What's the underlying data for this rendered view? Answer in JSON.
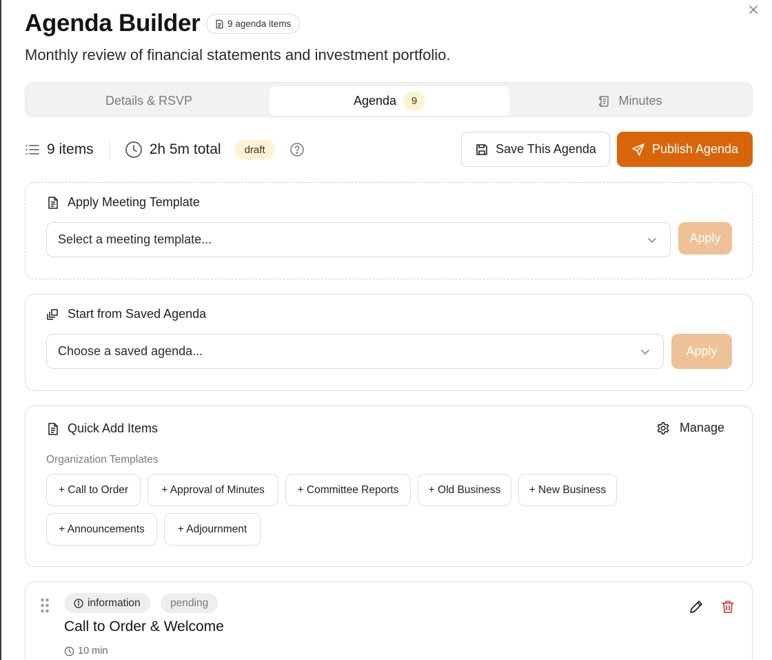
{
  "header": {
    "title": "Agenda Builder",
    "item_count_label": "9 agenda items",
    "subtitle": "Monthly review of financial statements and investment portfolio."
  },
  "tabs": [
    {
      "label": "Details & RSVP"
    },
    {
      "label": "Agenda",
      "badge": "9"
    },
    {
      "label": "Minutes"
    }
  ],
  "stats": {
    "items": "9 items",
    "total": "2h 5m total",
    "status": "draft"
  },
  "actions": {
    "save": "Save This Agenda",
    "publish": "Publish Agenda"
  },
  "template_section": {
    "heading": "Apply Meeting Template",
    "placeholder": "Select a meeting template...",
    "apply": "Apply"
  },
  "saved_section": {
    "heading": "Start from Saved Agenda",
    "placeholder": "Choose a saved agenda...",
    "apply": "Apply"
  },
  "quick_add": {
    "heading": "Quick Add Items",
    "manage": "Manage",
    "group_label": "Organization Templates",
    "chips": [
      "+ Call to Order",
      "+ Approval of Minutes",
      "+ Committee Reports",
      "+ Old Business",
      "+ New Business",
      "+ Announcements",
      "+ Adjournment"
    ]
  },
  "agenda_items": [
    {
      "type": "information",
      "status": "pending",
      "title": "Call to Order & Welcome",
      "duration": "10 min"
    }
  ],
  "colors": {
    "accent": "#d9650a",
    "accent_disabled": "#eec196",
    "badge_yellow": "#fdf3cf",
    "delete_red": "#c8323c"
  },
  "icons": {
    "close": "close-icon",
    "document": "document-icon",
    "list": "list-icon",
    "clock": "clock-icon",
    "help": "help-circle-icon",
    "save": "floppy-disk-icon",
    "send": "send-icon",
    "copy": "copy-stack-icon",
    "gear": "gear-icon",
    "scroll": "scroll-icon",
    "grip": "drag-handle-icon",
    "info": "info-icon",
    "edit": "pencil-icon",
    "delete": "trash-icon",
    "chevron": "chevron-down-icon"
  }
}
